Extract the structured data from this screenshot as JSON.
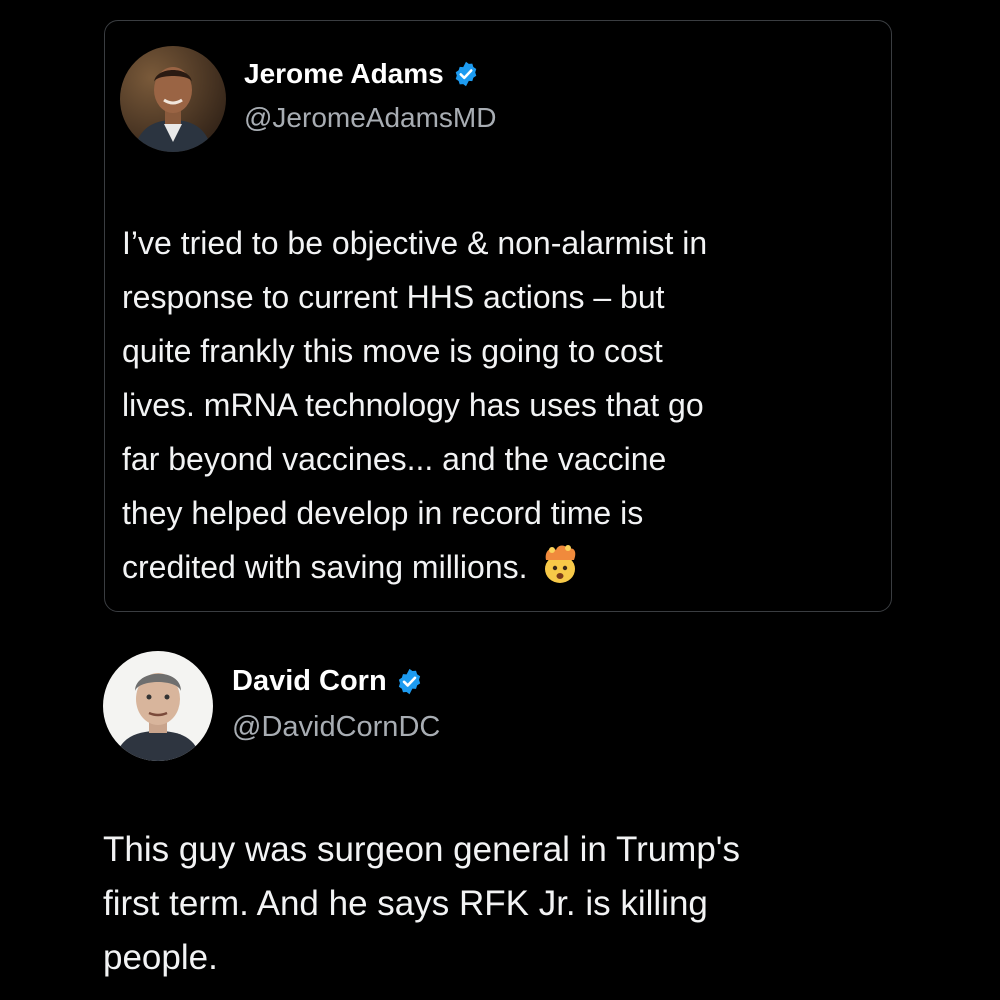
{
  "quoted_tweet": {
    "author_name": "Jerome Adams",
    "handle": "@JeromeAdamsMD",
    "verified": true,
    "avatar_icon": "profile-photo",
    "text": "I’ve tried to be objective & non-alarmist in\nresponse to current HHS actions – but\nquite frankly this move is going to cost\nlives. mRNA technology has uses that go\nfar beyond vaccines... and the vaccine\nthey helped develop in record time is\ncredited with saving millions.",
    "emoji": "exploding-head-emoji"
  },
  "main_tweet": {
    "author_name": "David Corn",
    "handle": "@DavidCornDC",
    "verified": true,
    "avatar_icon": "profile-photo",
    "text": "This guy was surgeon general in Trump's\nfirst term. And he says RFK Jr. is killing\npeople."
  },
  "colors": {
    "background": "#000000",
    "card_border": "#3a3d41",
    "text_primary": "#f2f3f4",
    "text_secondary": "#a8adb3",
    "verified_badge": "#1d9bf0"
  }
}
